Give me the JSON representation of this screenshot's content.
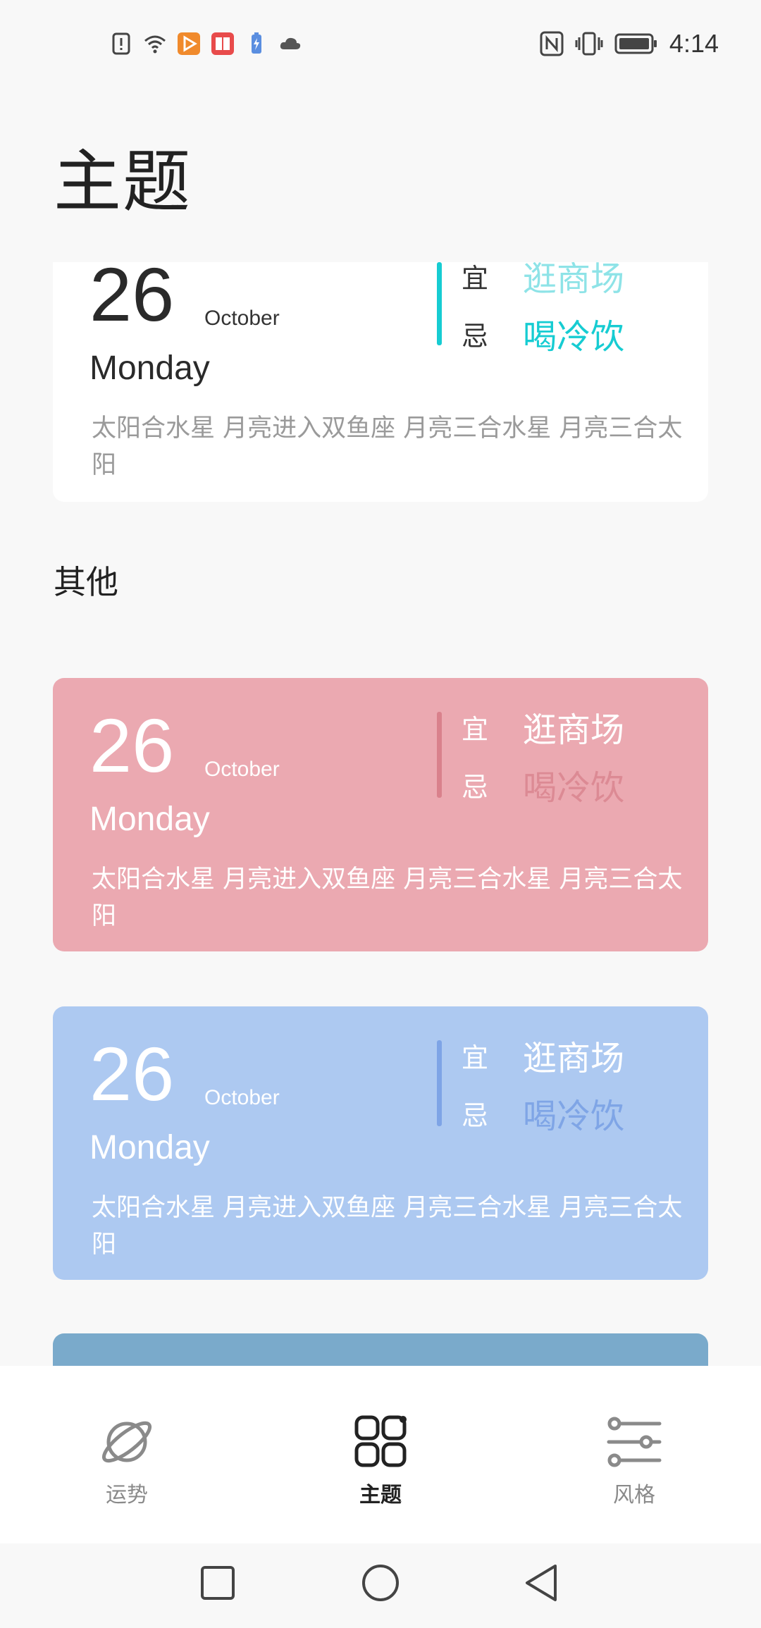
{
  "status_bar": {
    "time": "4:14",
    "left_icons": [
      "alert-icon",
      "wifi-icon",
      "video-app-icon",
      "book-app-icon",
      "battery-saver-icon",
      "cloud-icon"
    ],
    "right_icons": [
      "nfc-icon",
      "vibrate-icon",
      "battery-icon"
    ]
  },
  "header": {
    "title": "主题"
  },
  "section": {
    "others_title": "其他"
  },
  "cards": [
    {
      "day": "26",
      "month": "October",
      "weekday": "Monday",
      "yi_label": "宜",
      "yi_value": "逛商场",
      "ji_label": "忌",
      "ji_value": "喝冷饮",
      "description": "太阳合水星 月亮进入双鱼座 月亮三合水星 月亮三合太阳",
      "bg_color": "#ffffff",
      "accent_color": "#16ccd2"
    },
    {
      "day": "26",
      "month": "October",
      "weekday": "Monday",
      "yi_label": "宜",
      "yi_value": "逛商场",
      "ji_label": "忌",
      "ji_value": "喝冷饮",
      "description": "太阳合水星 月亮进入双鱼座 月亮三合水星 月亮三合太阳",
      "bg_color": "#eba9b1",
      "accent_color": "#d9818c"
    },
    {
      "day": "26",
      "month": "October",
      "weekday": "Monday",
      "yi_label": "宜",
      "yi_value": "逛商场",
      "ji_label": "忌",
      "ji_value": "喝冷饮",
      "description": "太阳合水星 月亮进入双鱼座 月亮三合水星 月亮三合太阳",
      "bg_color": "#adc9f1",
      "accent_color": "#7ea4e6"
    },
    {
      "bg_color": "#7aaacb"
    }
  ],
  "bottom_nav": {
    "items": [
      {
        "label": "运势",
        "icon": "planet-icon",
        "active": false
      },
      {
        "label": "主题",
        "icon": "grid-icon",
        "active": true
      },
      {
        "label": "风格",
        "icon": "sliders-icon",
        "active": false
      }
    ],
    "active_color": "#222222",
    "inactive_color": "#8a8a8a"
  },
  "system_nav": [
    "recents-button",
    "home-button",
    "back-button"
  ]
}
